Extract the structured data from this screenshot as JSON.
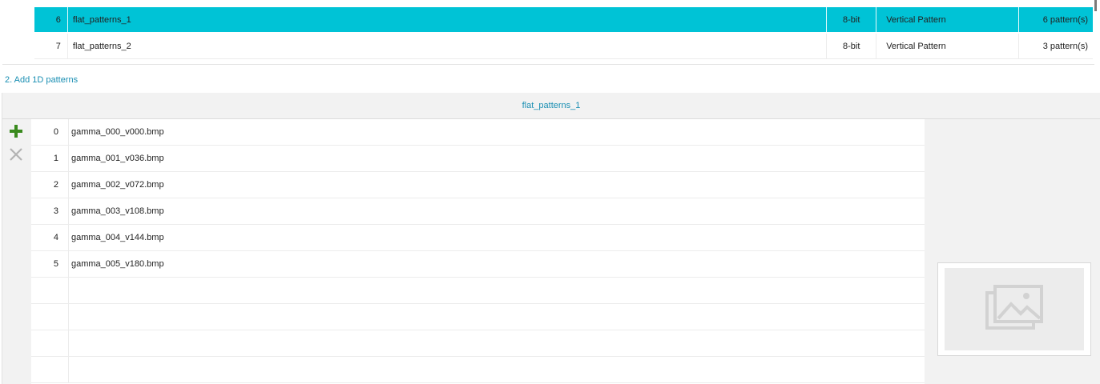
{
  "pattern_sets": [
    {
      "index": "6",
      "name": "flat_patterns_1",
      "bit_depth": "8-bit",
      "type": "Vertical Pattern",
      "count": "6 pattern(s)",
      "selected": true
    },
    {
      "index": "7",
      "name": "flat_patterns_2",
      "bit_depth": "8-bit",
      "type": "Vertical Pattern",
      "count": "3 pattern(s)",
      "selected": false
    }
  ],
  "section": {
    "title": "2. Add 1D patterns"
  },
  "panel": {
    "header": "flat_patterns_1"
  },
  "toolbar": {
    "add_icon": "plus-icon",
    "remove_icon": "close-icon",
    "accent_add": "#3a8a1e",
    "accent_remove": "#b3b3b3"
  },
  "patterns": [
    {
      "index": "0",
      "file": "gamma_000_v000.bmp"
    },
    {
      "index": "1",
      "file": "gamma_001_v036.bmp"
    },
    {
      "index": "2",
      "file": "gamma_002_v072.bmp"
    },
    {
      "index": "3",
      "file": "gamma_003_v108.bmp"
    },
    {
      "index": "4",
      "file": "gamma_004_v144.bmp"
    },
    {
      "index": "5",
      "file": "gamma_005_v180.bmp"
    }
  ],
  "preview": {
    "icon": "image-placeholder-icon"
  },
  "colors": {
    "selected_row": "#00c3d6",
    "accent_text": "#1a8fb3"
  }
}
